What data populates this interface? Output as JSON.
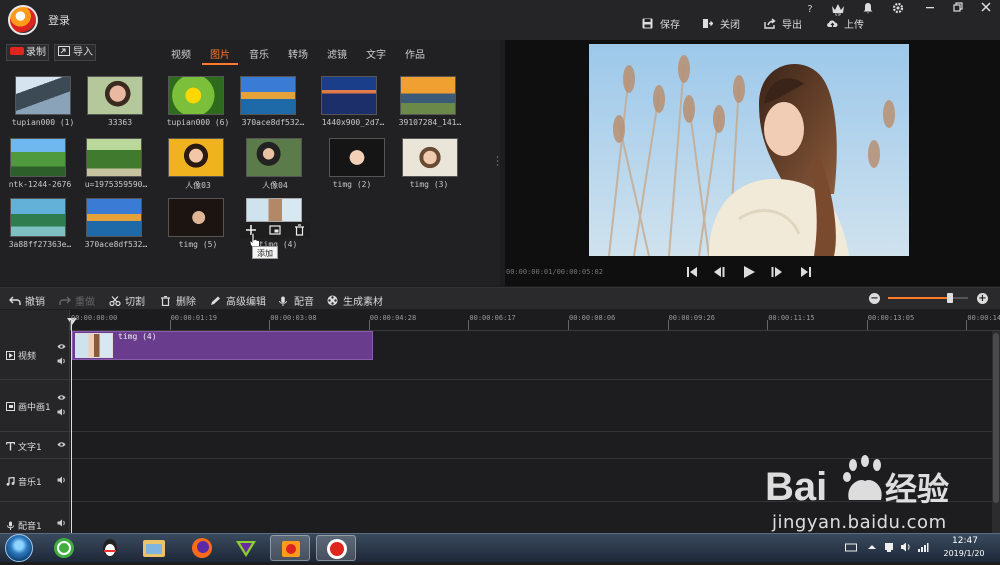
{
  "header": {
    "login": "登录",
    "actions": [
      {
        "label": "保存",
        "icon": "save-icon"
      },
      {
        "label": "关闭",
        "icon": "exit-icon"
      },
      {
        "label": "导出",
        "icon": "export-icon"
      },
      {
        "label": "上传",
        "icon": "cloud-upload-icon"
      }
    ],
    "window_buttons": [
      "?",
      "VIP",
      "bell",
      "gear",
      "minimize",
      "restore",
      "close"
    ],
    "help_label": "?"
  },
  "library": {
    "record_label": "录制",
    "import_label": "导入",
    "tabs": [
      "视频",
      "图片",
      "音乐",
      "转场",
      "滤镜",
      "文字",
      "作品"
    ],
    "active_tab": "图片",
    "items": [
      {
        "caption": "tupian000 (1)"
      },
      {
        "caption": "33363"
      },
      {
        "caption": "tupian000 (6)"
      },
      {
        "caption": "370ace8df532…"
      },
      {
        "caption": "1440x900_2d7…"
      },
      {
        "caption": "39107284_141…"
      },
      {
        "caption": "ntk-1244-2676"
      },
      {
        "caption": "u=1975359590…"
      },
      {
        "caption": "人像03"
      },
      {
        "caption": "人像04"
      },
      {
        "caption": "timg (2)"
      },
      {
        "caption": "timg (3)"
      },
      {
        "caption": "3a88ff27363e…"
      },
      {
        "caption": "370ace8df532…"
      },
      {
        "caption": "timg (5)"
      },
      {
        "caption": "timg (4)"
      }
    ],
    "hover_tooltip": "添加"
  },
  "preview": {
    "time": "00:00:00:01/00:00:05:02"
  },
  "edit_toolbar": {
    "undo": "撤销",
    "redo": "重做",
    "cut": "切割",
    "delete": "删除",
    "advanced": "高级编辑",
    "voiceover": "配音",
    "generate": "生成素材",
    "zoom_level": 0.78
  },
  "timeline": {
    "ticks": [
      "00:00:00:00",
      "00:00:01:19",
      "00:00:03:08",
      "00:00:04:28",
      "00:00:06:17",
      "00:00:08:06",
      "00:00:09:26",
      "00:00:11:15",
      "00:00:13:05",
      "00:00:14:"
    ],
    "tracks": [
      {
        "label": "视频",
        "icon": "play-square-icon"
      },
      {
        "label": "画中画1",
        "icon": "pip-icon"
      },
      {
        "label": "文字1",
        "icon": "text-icon"
      },
      {
        "label": "音乐1",
        "icon": "music-note-icon"
      },
      {
        "label": "配音1",
        "icon": "microphone-icon"
      }
    ],
    "clip_label": "timg (4)"
  },
  "taskbar": {
    "time": "12:47",
    "date": "2019/1/20"
  },
  "watermark": {
    "brand": "Bai du 经验",
    "url": "jingyan.baidu.com"
  },
  "colors": {
    "accent": "#ff7a2a",
    "clip": "#6a3c8e",
    "record": "#e0251c"
  }
}
